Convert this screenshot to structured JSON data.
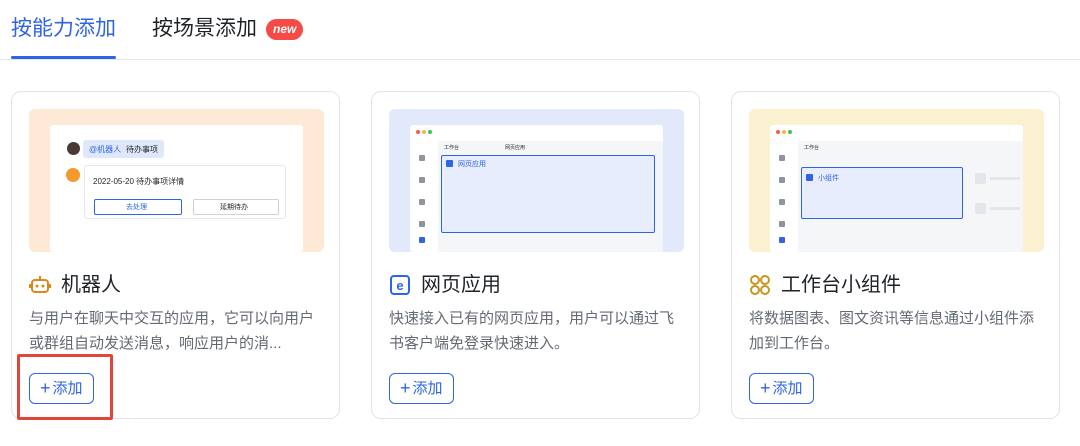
{
  "tabs": {
    "ability": "按能力添加",
    "scene": "按场景添加",
    "new_badge": "new"
  },
  "cards": [
    {
      "title": "机器人",
      "icon": "robot-icon",
      "description": "与用户在聊天中交互的应用，它可以向用户或群组自动发送消息，响应用户的消...",
      "add_label": "添加",
      "preview": {
        "mention": "@机器人",
        "task_title": "待办事项",
        "task_detail": "2022-05-20 待办事项详情",
        "btn_handle": "去处理",
        "btn_defer": "延期待办"
      }
    },
    {
      "title": "网页应用",
      "icon": "web-app-icon",
      "description": "快速接入已有的网页应用，用户可以通过飞书客户端免登录快速进入。",
      "add_label": "添加",
      "preview": {
        "tab_workbench": "工作台",
        "tab_web": "网页应用",
        "panel_label": "网页应用"
      }
    },
    {
      "title": "工作台小组件",
      "icon": "widget-icon",
      "description": "将数据图表、图文资讯等信息通过小组件添加到工作台。",
      "add_label": "添加",
      "preview": {
        "tab_workbench": "工作台",
        "panel_label": "小组件"
      }
    }
  ],
  "colors": {
    "accent": "#2e64e6",
    "badge": "#f54a45",
    "highlight": "#e1463b",
    "robot_icon": "#d98a1c",
    "widget_icon": "#c8961b"
  }
}
